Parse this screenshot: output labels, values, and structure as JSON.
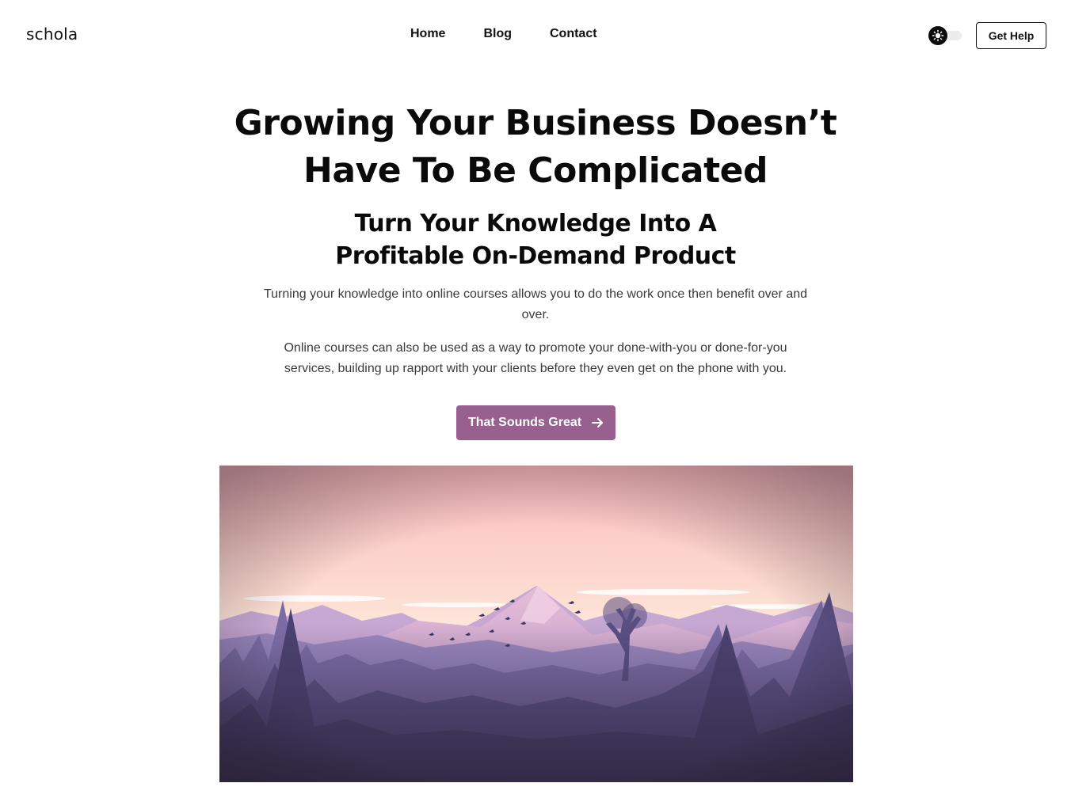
{
  "header": {
    "logo": "schola",
    "nav": [
      "Home",
      "Blog",
      "Contact"
    ],
    "theme_toggle_icon": "sun-icon",
    "help_button": "Get Help"
  },
  "hero": {
    "title_lines": [
      "Growing Your Business Doesn’t",
      "Have To Be Complicated"
    ],
    "subtitle_lines": [
      "Turn Your Knowledge Into A",
      "Profitable On-Demand Product"
    ],
    "paragraph_1": "Turning your knowledge into online courses allows you to do the work once then benefit over and over.",
    "paragraph_2": "Online courses can also be used as a way to promote your done-with-you or done-for-you services, building up rapport with your clients before they even get on the phone with you.",
    "cta_label": "That Sounds Great",
    "cta_icon": "arrow-right-icon",
    "image_subject": "mountain-forest-sunset-illustration"
  },
  "colors": {
    "accent": "#98608f",
    "text": "#0a0a0a",
    "body_text": "#3a3a3a"
  }
}
